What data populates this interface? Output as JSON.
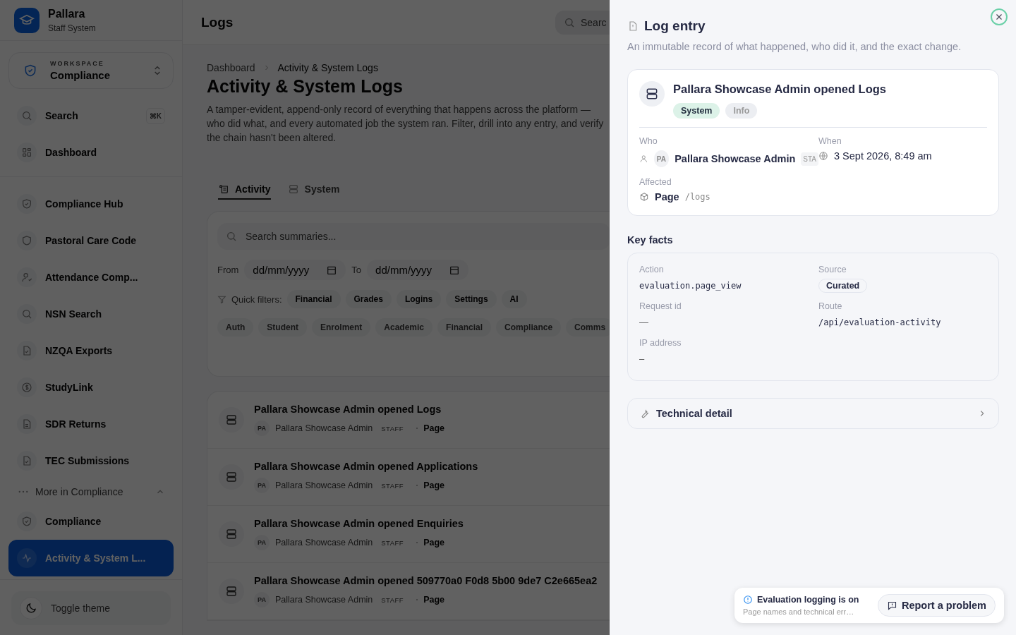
{
  "app": {
    "name": "Pallara",
    "subtitle": "Staff System"
  },
  "workspace": {
    "label": "WORKSPACE",
    "name": "Compliance"
  },
  "sidebar": {
    "groups": [
      [
        {
          "label": "Search",
          "shortcut": "⌘K",
          "selected": false
        },
        {
          "label": "Dashboard",
          "selected": false
        }
      ],
      [
        {
          "label": "Compliance Hub",
          "selected": false
        },
        {
          "label": "Pastoral Care Code",
          "selected": false
        },
        {
          "label": "Attendance Comp...",
          "selected": false
        },
        {
          "label": "NSN Search",
          "selected": false
        },
        {
          "label": "NZQA Exports",
          "selected": false
        },
        {
          "label": "StudyLink",
          "selected": false
        },
        {
          "label": "SDR Returns",
          "selected": false
        },
        {
          "label": "TEC Submissions",
          "selected": false
        }
      ]
    ],
    "more": {
      "label": "More in Compliance",
      "expanded": true
    },
    "more_items": [
      {
        "label": "Compliance",
        "selected": false
      },
      {
        "label": "Activity & System L...",
        "selected": true
      }
    ],
    "toggle_theme": "Toggle theme"
  },
  "header": {
    "title": "Logs",
    "search_placeholder": "Searc"
  },
  "breadcrumb": [
    "Dashboard",
    "Activity & System Logs"
  ],
  "page": {
    "title": "Activity & System Logs",
    "description": "A tamper-evident, append-only record of everything that happens across the platform — who did what, and every automated job the system ran. Filter, drill into any entry, and verify the chain hasn't been altered."
  },
  "tabs": [
    {
      "label": "Activity",
      "selected": true
    },
    {
      "label": "System",
      "selected": false
    }
  ],
  "filters": {
    "search_placeholder": "Search summaries...",
    "from_label": "From",
    "to_label": "To",
    "from_placeholder": "dd/mm/yyyy",
    "to_placeholder": "dd/mm/yyyy",
    "quick_label": "Quick filters:",
    "quick": [
      "Financial",
      "Grades",
      "Logins",
      "Settings",
      "AI"
    ],
    "categories": [
      "Auth",
      "Student",
      "Enrolment",
      "Academic",
      "Financial",
      "Compliance",
      "Comms"
    ]
  },
  "logs": [
    {
      "title": "Pallara Showcase Admin opened Logs",
      "initials": "PA",
      "actor": "Pallara Showcase Admin",
      "role": "STAFF",
      "target": "Page"
    },
    {
      "title": "Pallara Showcase Admin opened Applications",
      "initials": "PA",
      "actor": "Pallara Showcase Admin",
      "role": "STAFF",
      "target": "Page"
    },
    {
      "title": "Pallara Showcase Admin opened Enquiries",
      "initials": "PA",
      "actor": "Pallara Showcase Admin",
      "role": "STAFF",
      "target": "Page"
    },
    {
      "title": "Pallara Showcase Admin opened 509770a0 F0d8 5b00 9de7 C2e665ea2",
      "initials": "PA",
      "actor": "Pallara Showcase Admin",
      "role": "STAFF",
      "target": "Page"
    }
  ],
  "drawer": {
    "title": "Log entry",
    "subtitle": "An immutable record of what happened, who did it, and the exact change.",
    "entry": {
      "title": "Pallara Showcase Admin opened Logs",
      "tags": [
        {
          "label": "System",
          "color": "#dcf2e8"
        },
        {
          "label": "Info",
          "color": "#eceef2"
        }
      ],
      "who_label": "Who",
      "initials": "PA",
      "actor": "Pallara Showcase Admin",
      "role": "STA",
      "when_label": "When",
      "when": "3 Sept 2026, 8:49 am",
      "affected_label": "Affected",
      "affected": "Page",
      "affected_path": "/logs"
    },
    "key_facts_title": "Key facts",
    "facts": [
      {
        "label": "Action",
        "value": "evaluation.page_view",
        "kind": "mono"
      },
      {
        "label": "Source",
        "value": "Curated",
        "kind": "badge"
      },
      {
        "label": "Request id",
        "value": "—",
        "kind": "text"
      },
      {
        "label": "Route",
        "value": "/api/evaluation-activity",
        "kind": "mono"
      },
      {
        "label": "IP address",
        "value": "–",
        "kind": "text"
      }
    ],
    "technical": {
      "label": "Technical detail",
      "expanded": false
    }
  },
  "toast": {
    "title": "Evaluation logging is on",
    "text": "Page names and technical err…",
    "button": "Report a problem"
  }
}
